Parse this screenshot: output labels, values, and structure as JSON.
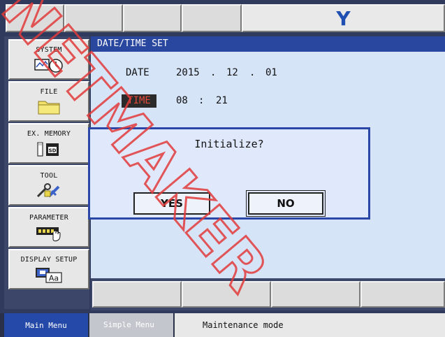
{
  "top_bar": {
    "logo_letter": "Y"
  },
  "sidebar": {
    "items": [
      {
        "label": "SYSTEM",
        "icon": "system-icon"
      },
      {
        "label": "FILE",
        "icon": "folder-icon"
      },
      {
        "label": "EX. MEMORY",
        "icon": "sd-card-icon"
      },
      {
        "label": "TOOL",
        "icon": "tool-icon"
      },
      {
        "label": "PARAMETER",
        "icon": "parameter-icon"
      },
      {
        "label": "DISPLAY SETUP",
        "icon": "display-setup-icon"
      }
    ]
  },
  "main": {
    "title": "DATE/TIME SET",
    "date_label": "DATE",
    "date_year": "2015",
    "date_month": "12",
    "date_day": "01",
    "date_sep": ".",
    "time_label": "TIME",
    "time_hour": "08",
    "time_minute": "21",
    "time_sep": ":"
  },
  "dialog": {
    "title": "Initialize?",
    "yes_label": "YES",
    "no_label": "NO"
  },
  "status_bar": {
    "main_menu": "Main Menu",
    "simple_menu": "Simple Menu",
    "mode": "Maintenance mode"
  },
  "watermark": {
    "text": "NETMAKER"
  },
  "colors": {
    "title_bar": "#29479e",
    "panel": "#d6e4f8",
    "dialog_border": "#2a47a8",
    "watermark": "#e23b3b",
    "time_label_text": "#e34a3a",
    "logo": "#1f4fb0"
  }
}
